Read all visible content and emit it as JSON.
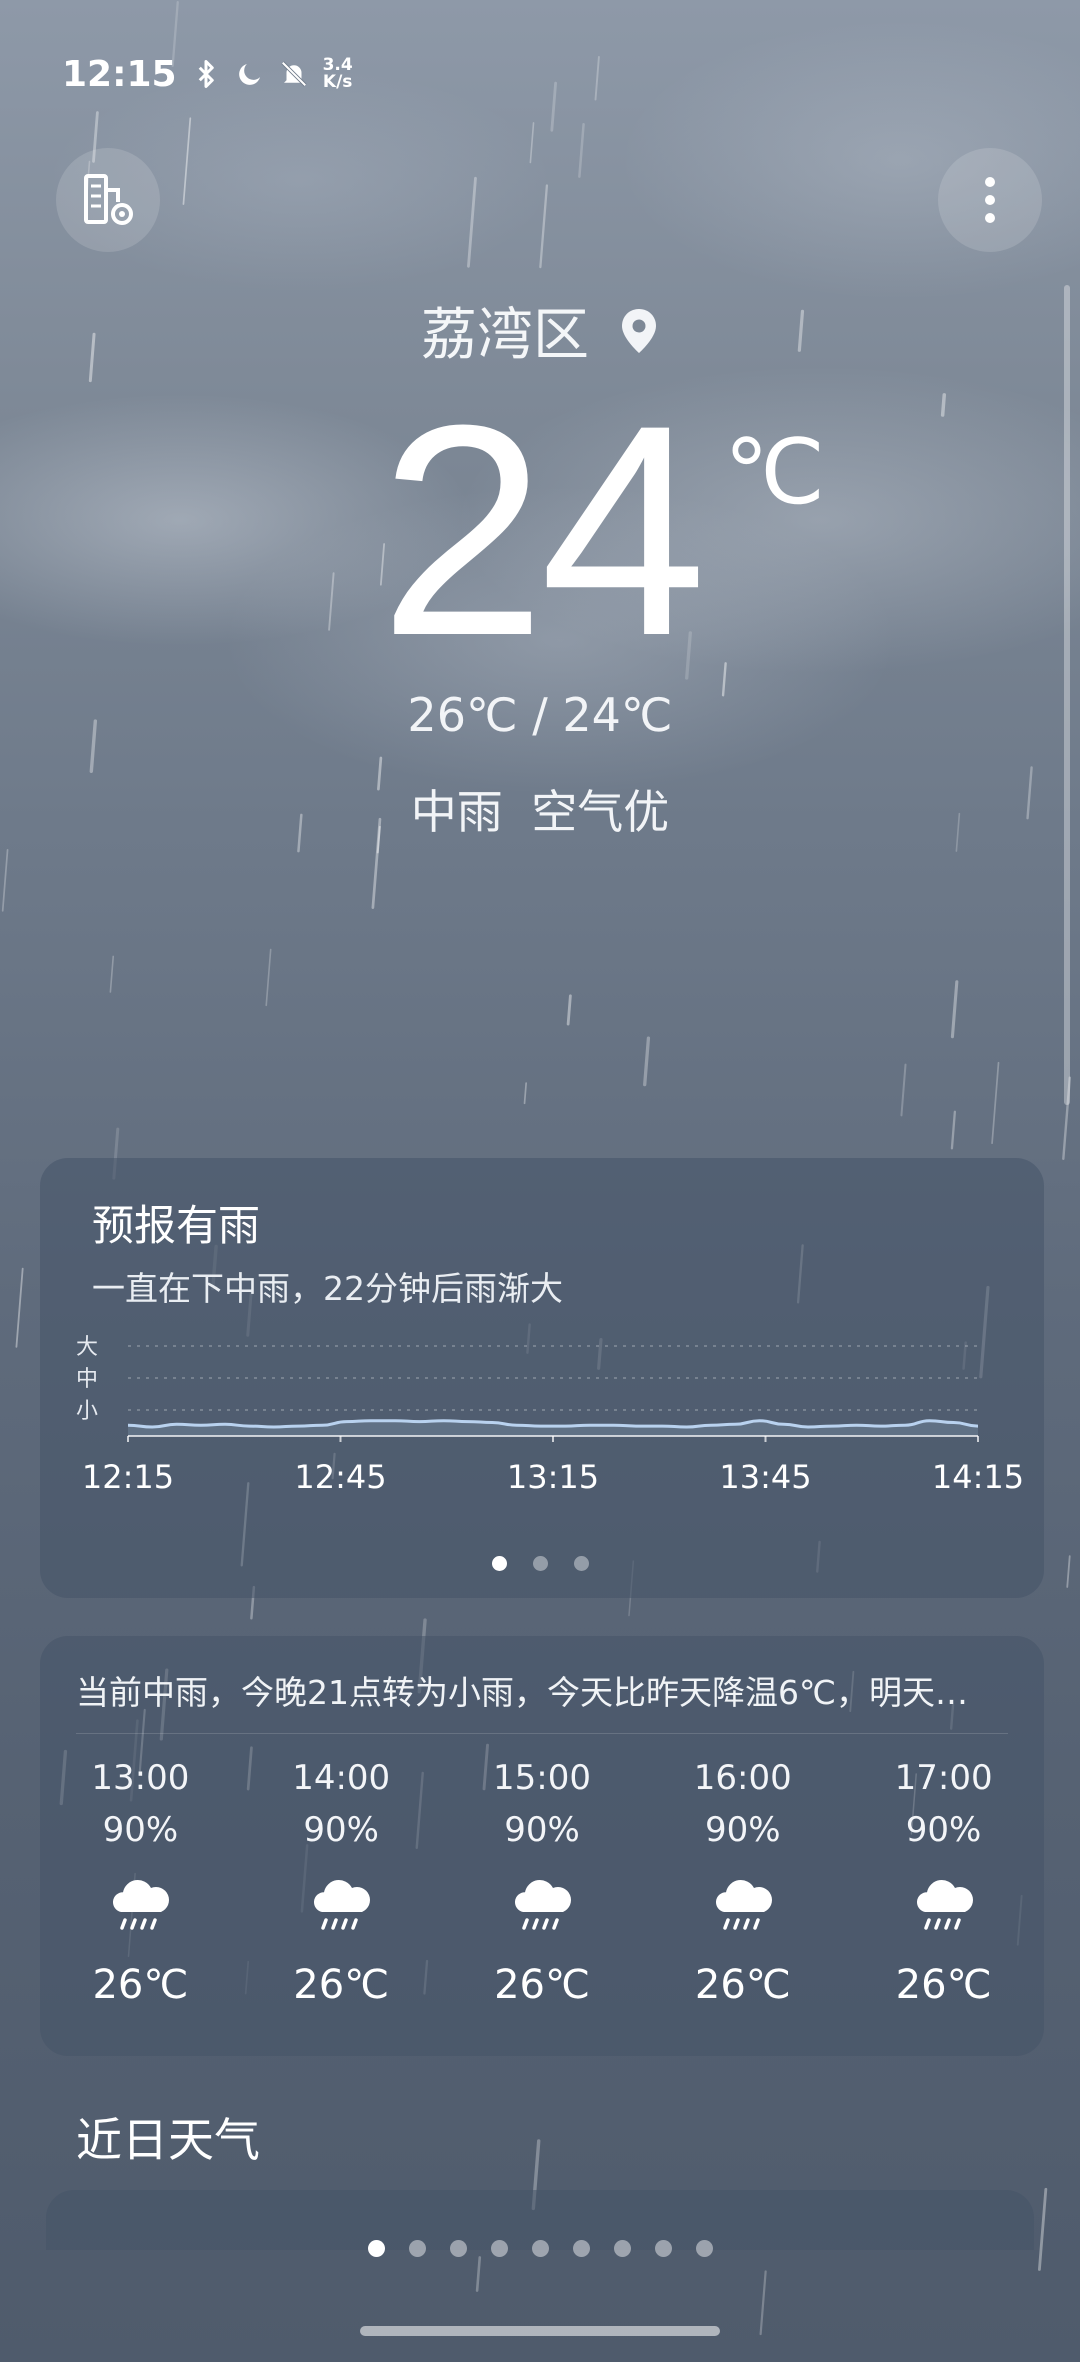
{
  "status_bar": {
    "time": "12:15",
    "net_speed_value": "3.4",
    "net_speed_unit": "K/s",
    "icons": [
      "bluetooth-icon",
      "do-not-disturb-moon-icon",
      "bell-muted-icon"
    ]
  },
  "header": {
    "left_button_icon": "city-manage-icon",
    "right_button_icon": "more-vertical-icon"
  },
  "location": {
    "name": "荔湾区",
    "icon": "location-pin-icon"
  },
  "current": {
    "temperature": "24",
    "unit": "℃",
    "high_low": "26℃ / 24℃",
    "condition": "中雨 空气优"
  },
  "rain_forecast": {
    "title": "预报有雨",
    "subtitle": "一直在下中雨，22分钟后雨渐大",
    "levels": [
      "大",
      "中",
      "小"
    ],
    "time_labels": [
      "12:15",
      "12:45",
      "13:15",
      "13:45",
      "14:15"
    ],
    "intensity_series": [
      0.12,
      0.1,
      0.13,
      0.12,
      0.13,
      0.11,
      0.1,
      0.11,
      0.12,
      0.16,
      0.17,
      0.17,
      0.16,
      0.17,
      0.16,
      0.15,
      0.12,
      0.11,
      0.11,
      0.12,
      0.12,
      0.11,
      0.11,
      0.1,
      0.12,
      0.13,
      0.17,
      0.13,
      0.1,
      0.11,
      0.12,
      0.11,
      0.12,
      0.17,
      0.15,
      0.11
    ],
    "pager": {
      "count": 3,
      "active": 0
    }
  },
  "hourly": {
    "summary": "当前中雨，今晚21点转为小雨，今天比昨天降温6℃，明天…",
    "items": [
      {
        "time": "13:00",
        "precip": "90%",
        "icon": "rain-cloud-icon",
        "temp": "26℃"
      },
      {
        "time": "14:00",
        "precip": "90%",
        "icon": "rain-cloud-icon",
        "temp": "26℃"
      },
      {
        "time": "15:00",
        "precip": "90%",
        "icon": "rain-cloud-icon",
        "temp": "26℃"
      },
      {
        "time": "16:00",
        "precip": "90%",
        "icon": "rain-cloud-icon",
        "temp": "26℃"
      },
      {
        "time": "17:00",
        "precip": "90%",
        "icon": "rain-cloud-icon",
        "temp": "26℃"
      }
    ]
  },
  "recent": {
    "title": "近日天气"
  },
  "page_indicator": {
    "count": 9,
    "active": 0
  }
}
